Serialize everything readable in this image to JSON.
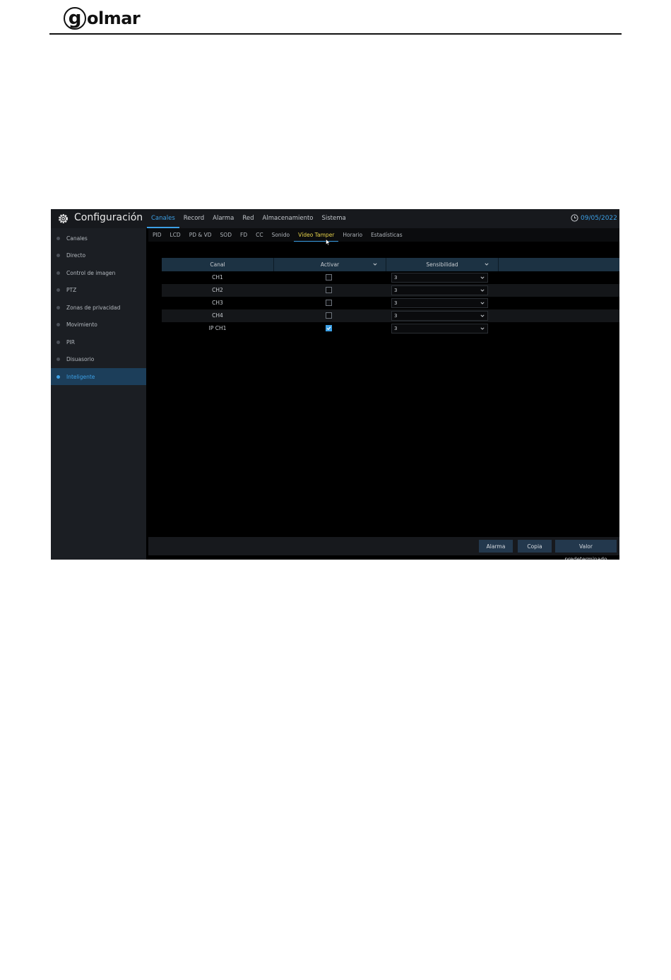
{
  "header": {
    "logo_glyph": "g",
    "logo_text": "olmar"
  },
  "ui": {
    "app_title": "Configuración",
    "date": "09/05/2022 1",
    "accent_color": "#3ca0e6",
    "main_tabs": [
      "Canales",
      "Record",
      "Alarma",
      "Red",
      "Almacenamiento",
      "Sistema"
    ],
    "active_main_tab": "Canales",
    "sidebar": [
      "Canales",
      "Directo",
      "Control de imagen",
      "PTZ",
      "Zonas de privacidad",
      "Movimiento",
      "PIR",
      "Disuasorio",
      "Inteligente"
    ],
    "active_sidebar": "Inteligente",
    "sub_tabs": [
      "PID",
      "LCD",
      "PD & VD",
      "SOD",
      "FD",
      "CC",
      "Sonido",
      "Vídeo Tamper",
      "Horario",
      "Estadísticas"
    ],
    "active_sub_tab": "Vídeo Tamper",
    "table": {
      "headers": [
        "Canal",
        "Activar",
        "Sensibilidad"
      ],
      "rows": [
        {
          "canal": "CH1",
          "activar": false,
          "sensibilidad": "3"
        },
        {
          "canal": "CH2",
          "activar": false,
          "sensibilidad": "3"
        },
        {
          "canal": "CH3",
          "activar": false,
          "sensibilidad": "3"
        },
        {
          "canal": "CH4",
          "activar": false,
          "sensibilidad": "3"
        },
        {
          "canal": "IP CH1",
          "activar": true,
          "sensibilidad": "3"
        }
      ]
    },
    "buttons": {
      "alarma": "Alarma",
      "copia": "Copia",
      "default": "Valor predeterminado"
    }
  }
}
